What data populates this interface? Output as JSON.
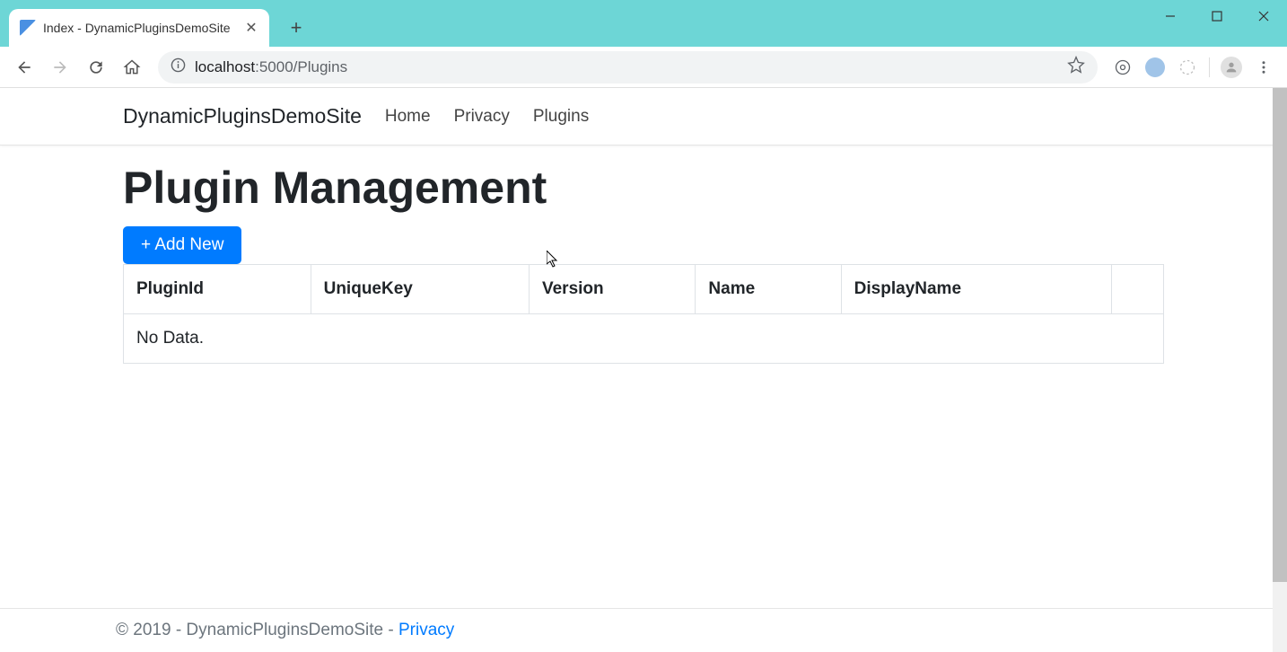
{
  "browser": {
    "tab_title": "Index - DynamicPluginsDemoSite",
    "url_host": "localhost",
    "url_port": ":5000",
    "url_path": "/Plugins"
  },
  "navbar": {
    "brand": "DynamicPluginsDemoSite",
    "links": [
      "Home",
      "Privacy",
      "Plugins"
    ]
  },
  "page": {
    "title": "Plugin Management",
    "add_button": "+ Add New",
    "table_headers": [
      "PluginId",
      "UniqueKey",
      "Version",
      "Name",
      "DisplayName",
      ""
    ],
    "no_data": "No Data."
  },
  "footer": {
    "copyright": "© 2019 - DynamicPluginsDemoSite - ",
    "privacy_link": "Privacy"
  }
}
